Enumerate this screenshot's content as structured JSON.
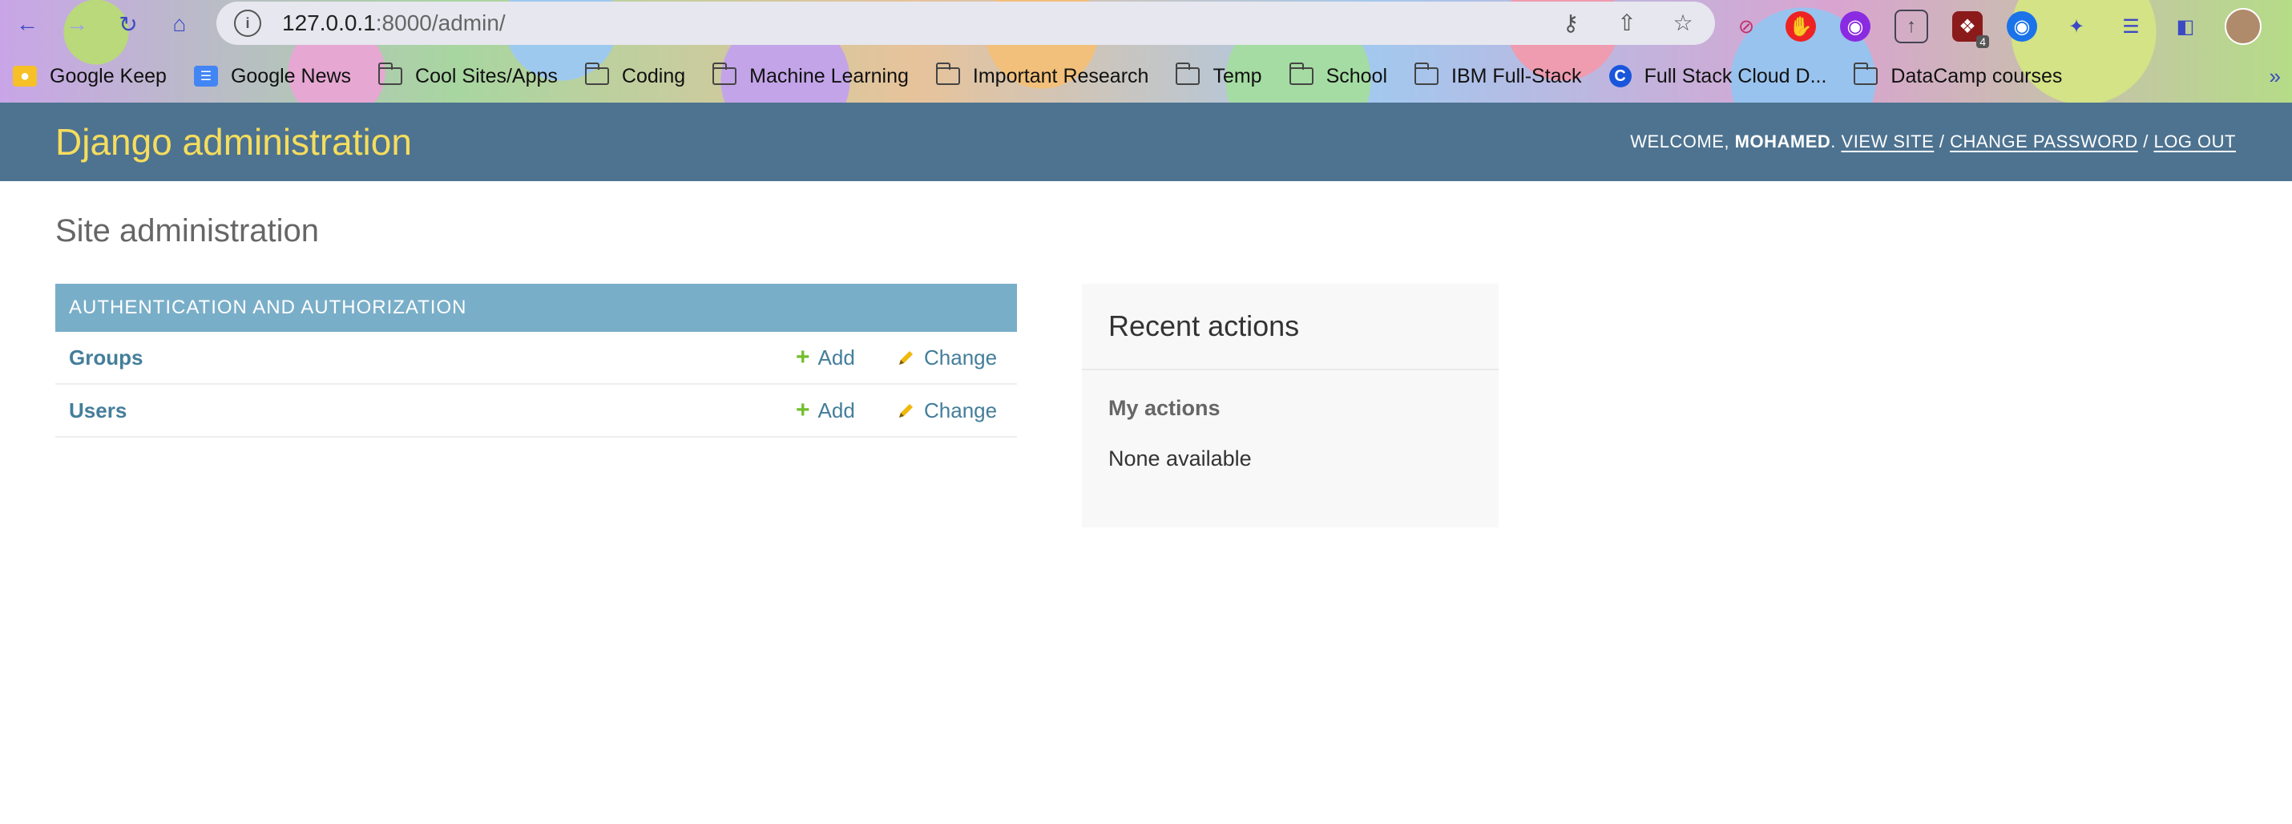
{
  "browser": {
    "url_host": "127.0.0.1",
    "url_rest": ":8000/admin/",
    "bookmarks": [
      {
        "label": "Google Keep",
        "type": "keep"
      },
      {
        "label": "Google News",
        "type": "news"
      },
      {
        "label": "Cool Sites/Apps",
        "type": "folder"
      },
      {
        "label": "Coding",
        "type": "folder"
      },
      {
        "label": "Machine Learning",
        "type": "folder"
      },
      {
        "label": "Important Research",
        "type": "folder"
      },
      {
        "label": "Temp",
        "type": "folder"
      },
      {
        "label": "School",
        "type": "folder"
      },
      {
        "label": "IBM Full-Stack",
        "type": "folder"
      },
      {
        "label": "Full Stack Cloud D...",
        "type": "site"
      },
      {
        "label": "DataCamp courses",
        "type": "folder"
      }
    ],
    "extension_badge": "4"
  },
  "header": {
    "branding": "Django administration",
    "welcome": "WELCOME,",
    "username": "MOHAMED",
    "view_site": "VIEW SITE",
    "change_password": "CHANGE PASSWORD",
    "log_out": "LOG OUT",
    "separator": "/"
  },
  "content": {
    "title": "Site administration"
  },
  "module": {
    "caption": "AUTHENTICATION AND AUTHORIZATION",
    "add_label": "Add",
    "change_label": "Change",
    "models": [
      {
        "name": "Groups"
      },
      {
        "name": "Users"
      }
    ]
  },
  "recent": {
    "title": "Recent actions",
    "subtitle": "My actions",
    "empty": "None available"
  },
  "colors": {
    "header_bg": "#4e7390",
    "branding": "#f5dd5d",
    "caption_bg": "#79aec8",
    "link": "#447e9b",
    "add_icon": "#70bf2b",
    "change_icon": "#efb80b"
  }
}
